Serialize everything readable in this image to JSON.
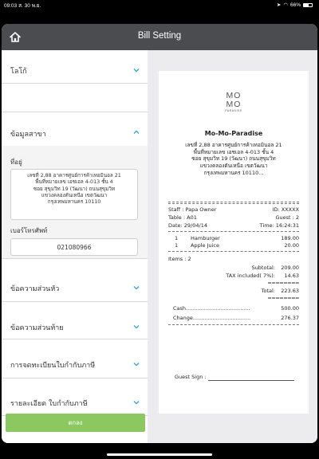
{
  "status_bar": {
    "time": "09:03",
    "date": "ส. 30 พ.ย.",
    "battery": "66%"
  },
  "header": {
    "title": "Bill Setting"
  },
  "sections": {
    "logo": "โลโก้",
    "branch": "ข้อมูลสาขา",
    "header_text": "ข้อความส่วนหัว",
    "footer_text": "ข้อความส่วนท้าย",
    "tax_registration": "การจดทะเบียนใบกำกับภาษี",
    "tax_invoice_details": "รายละเอียด ใบกำกับภาษี"
  },
  "branch": {
    "address_label": "ที่อยู่",
    "address_lines": [
      "เลขที่ 2,88 อาคารศูนย์การค้าเทอมินอล 21",
      "พื้นที่หมายเลข เอชเอล 4-013 ชั้น 4",
      "ซอย สุขุมวิท 19 (วัฒนา) ถนนสุขุมวิท",
      "แขวงคลองตันเหนือ เขตวัฒนา",
      "กรุงเทพมหานคร 10110"
    ],
    "phone_label": "เบอร์โทรศัพท์",
    "phone_value": "021080966"
  },
  "ok_button": "ตกลง",
  "receipt": {
    "logo_top": "MO",
    "logo_bottom": "MO",
    "logo_sub": "PARADISE",
    "shop_name": "Mo-Mo-Paradise",
    "address_lines": [
      "เลขที่ 2,88 อาคารศูนย์การค้าเทอมินอล 21",
      "พื้นที่หมายเลข เอชเอล 4-013 ชั้น 4",
      "ซอย สุขุมวิท 19 (วัฒนา) ถนนสุขุมวิท",
      "แขวงคลองตันเหนือ เขตวัฒนา",
      "กรุงเทพมหานคร 10110..."
    ],
    "staff": "Staff : Papa Owner",
    "id": "ID: XXXXX",
    "table": "Table : A01",
    "guest": "Guest : 2",
    "date": "Date: 29/04/14",
    "time": "Time: 16:24:31",
    "items": [
      {
        "qty": "1",
        "name": "Hamburger",
        "price": "189.00"
      },
      {
        "qty": "1",
        "name": "Apple Juice",
        "price": "20.00"
      }
    ],
    "items_count": "Items : 2",
    "subtotal_label": "Subtotal:",
    "subtotal": "209.00",
    "tax_label": "TAX included( 7%):",
    "tax": "14.63",
    "total_label": "Total:",
    "total": "223.63",
    "equals": "========",
    "cash_label": "Cash.......................................",
    "cash": "500.00",
    "change_label": "Change...................................",
    "change": "276.37",
    "guest_sign": "Guest Sign :"
  },
  "colors": {
    "header_bg": "#4a4c50",
    "accent": "#36a9d6",
    "ok_button": "#8cc860"
  }
}
